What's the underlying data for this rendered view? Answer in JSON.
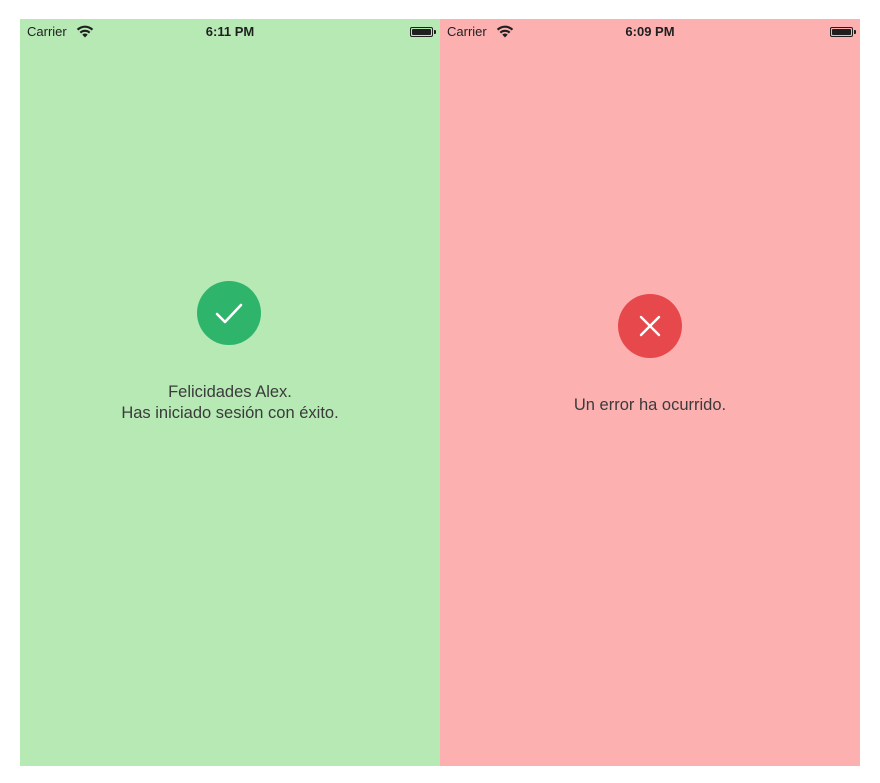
{
  "success_screen": {
    "status_bar": {
      "carrier": "Carrier",
      "time": "6:11 PM"
    },
    "icon": "checkmark-icon",
    "message_line1": "Felicidades Alex.",
    "message_line2": "Has iniciado sesión con éxito.",
    "background_color": "#b6e9b4",
    "icon_color": "#2fb46c"
  },
  "error_screen": {
    "status_bar": {
      "carrier": "Carrier",
      "time": "6:09 PM"
    },
    "icon": "close-icon",
    "message": "Un error ha ocurrido.",
    "background_color": "#fcb1b0",
    "icon_color": "#e7484c"
  }
}
